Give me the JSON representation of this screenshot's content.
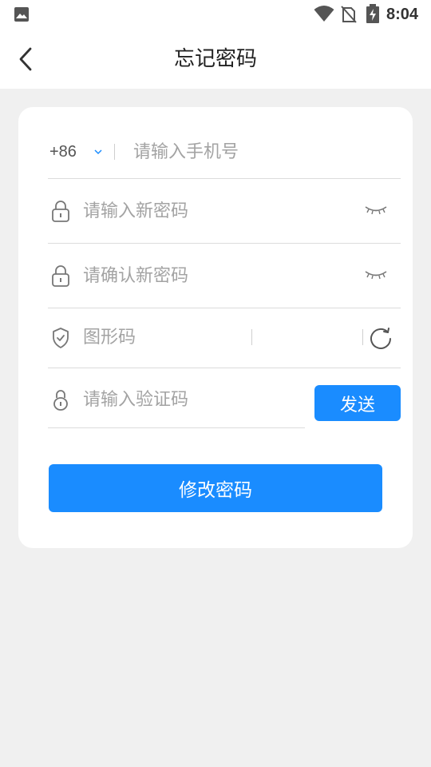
{
  "status_bar": {
    "time": "8:04",
    "icons": [
      "photo-icon",
      "wifi-icon",
      "no-sim-icon",
      "battery-charging-icon"
    ]
  },
  "header": {
    "title": "忘记密码",
    "back_icon": "chevron-left-icon"
  },
  "form": {
    "phone": {
      "country_code": "+86",
      "dropdown_icon": "chevron-down-icon",
      "placeholder": "请输入手机号",
      "value": ""
    },
    "new_password": {
      "icon": "lock-icon",
      "placeholder": "请输入新密码",
      "value": "",
      "toggle_icon": "eye-closed-icon"
    },
    "confirm_password": {
      "icon": "lock-icon",
      "placeholder": "请确认新密码",
      "value": "",
      "toggle_icon": "eye-closed-icon"
    },
    "captcha": {
      "icon": "shield-check-icon",
      "placeholder": "图形码",
      "value": "",
      "refresh_icon": "refresh-icon"
    },
    "sms_code": {
      "icon": "lock-icon",
      "placeholder": "请输入验证码",
      "value": "",
      "send_label": "发送"
    },
    "submit_label": "修改密码"
  },
  "colors": {
    "primary": "#1a8cff",
    "background": "#f0f0f0",
    "card": "#ffffff",
    "placeholder": "#a3a3a3",
    "divider": "#dcdcdc"
  }
}
